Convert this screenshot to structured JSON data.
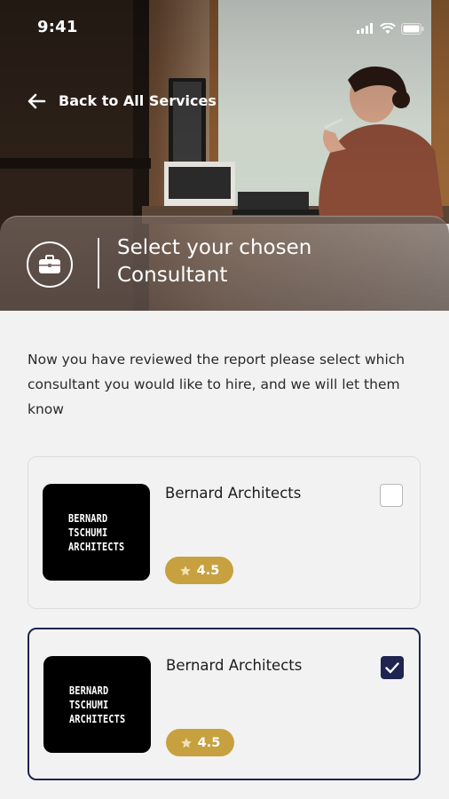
{
  "status_bar": {
    "time": "9:41"
  },
  "header": {
    "back_label": "Back to All Services",
    "title": "Select your chosen Consultant"
  },
  "intro_text": "Now you have reviewed the report please select which consultant you would like to hire, and we will let them know",
  "consultants": [
    {
      "logo_lines": "BERNARD\nTSCHUMI\nARCHITECTS",
      "name": "Bernard Architects",
      "rating": "4.5",
      "selected": false
    },
    {
      "logo_lines": "BERNARD\nTSCHUMI\nARCHITECTS",
      "name": "Bernard Architects",
      "rating": "4.5",
      "selected": true
    }
  ],
  "colors": {
    "accent": "#1f2550",
    "rating_bg": "#c7a13f",
    "background": "#f2f2f3"
  },
  "icons": {
    "back": "arrow-left-icon",
    "header_badge": "briefcase-icon",
    "rating": "star-icon",
    "checked": "checkmark-icon"
  }
}
